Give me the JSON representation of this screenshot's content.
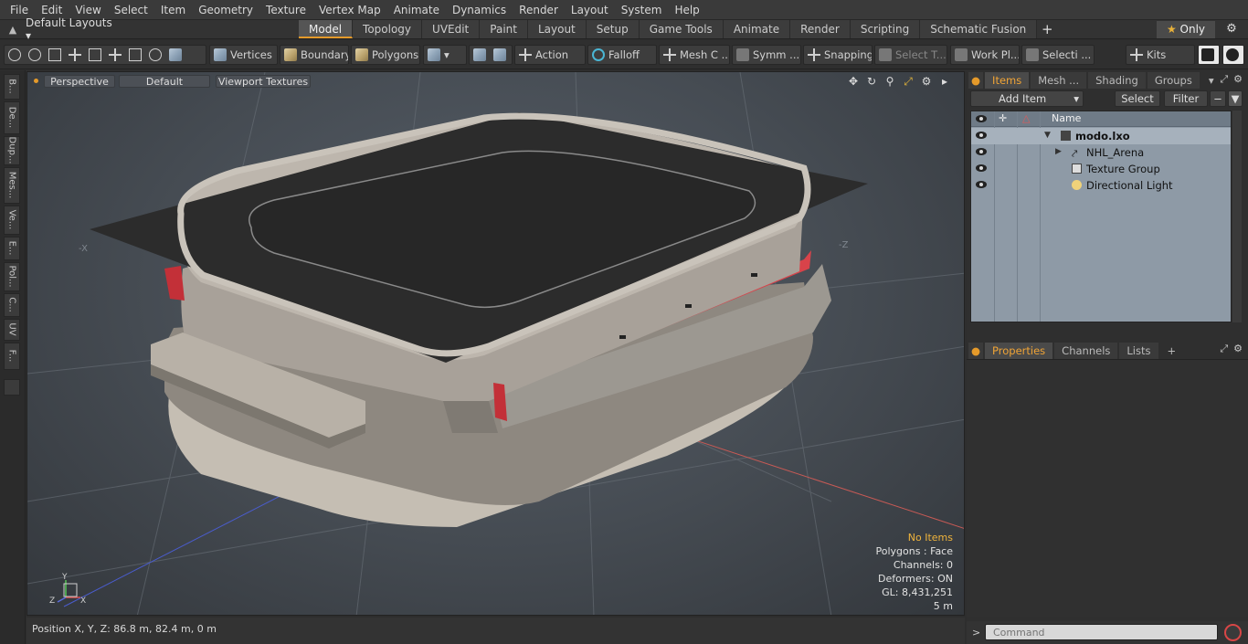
{
  "menu": [
    "File",
    "Edit",
    "View",
    "Select",
    "Item",
    "Geometry",
    "Texture",
    "Vertex Map",
    "Animate",
    "Dynamics",
    "Render",
    "Layout",
    "System",
    "Help"
  ],
  "layout_selector": "Default Layouts ▾",
  "tabs": [
    {
      "label": "Model",
      "active": true
    },
    {
      "label": "Topology"
    },
    {
      "label": "UVEdit"
    },
    {
      "label": "Paint"
    },
    {
      "label": "Layout"
    },
    {
      "label": "Setup"
    },
    {
      "label": "Game Tools"
    },
    {
      "label": "Animate"
    },
    {
      "label": "Render"
    },
    {
      "label": "Scripting"
    },
    {
      "label": "Schematic Fusion"
    }
  ],
  "tab_add": "+",
  "only_label": "Only",
  "toolbar": {
    "vertices": "Vertices",
    "boundary": "Boundary",
    "polygons": "Polygons",
    "action": "Action",
    "falloff": "Falloff",
    "mesh": "Mesh C ...",
    "symm": "Symm ...",
    "snapping": "Snapping",
    "select_t": "Select T...",
    "work_pl": "Work Pl...",
    "selecti": "Selecti ...",
    "kits": "Kits"
  },
  "left_strip": [
    "B...",
    "De...",
    "Dup...",
    "Mes...",
    "Ve...",
    "E...",
    "Pol...",
    "C...",
    "UV",
    "F..."
  ],
  "viewport": {
    "view_mode": "Perspective",
    "shading": "Default",
    "textures": "Viewport Textures",
    "axis_x_neg": "-X",
    "axis_z_neg": "-Z",
    "hud": {
      "items": "No Items",
      "polygons": "Polygons : Face",
      "channels": "Channels: 0",
      "deformers": "Deformers: ON",
      "gl": "GL: 8,431,251",
      "scale": "5 m"
    },
    "gizmo": {
      "x": "X",
      "y": "Y",
      "z": "Z"
    }
  },
  "status": {
    "position": "Position X, Y, Z:   86.8 m, 82.4 m, 0 m"
  },
  "items_panel": {
    "tabs": [
      {
        "label": "Items",
        "active": true
      },
      {
        "label": "Mesh ..."
      },
      {
        "label": "Shading"
      },
      {
        "label": "Groups"
      }
    ],
    "add_item": "Add Item",
    "select": "Select",
    "filter": "Filter",
    "col_name": "Name",
    "rows": [
      {
        "label": "modo.lxo",
        "depth": 0
      },
      {
        "label": "NHL_Arena",
        "depth": 1
      },
      {
        "label": "Texture Group",
        "depth": 1
      },
      {
        "label": "Directional Light",
        "depth": 1
      }
    ]
  },
  "props_panel": {
    "tabs": [
      {
        "label": "Properties",
        "active": true
      },
      {
        "label": "Channels"
      },
      {
        "label": "Lists"
      }
    ],
    "add": "+"
  },
  "command": {
    "prompt": ">",
    "placeholder": "Command"
  },
  "colors": {
    "accent": "#e59a2a",
    "outliner_bg": "#8e9aa6",
    "arena_red": "#d03a3a"
  }
}
